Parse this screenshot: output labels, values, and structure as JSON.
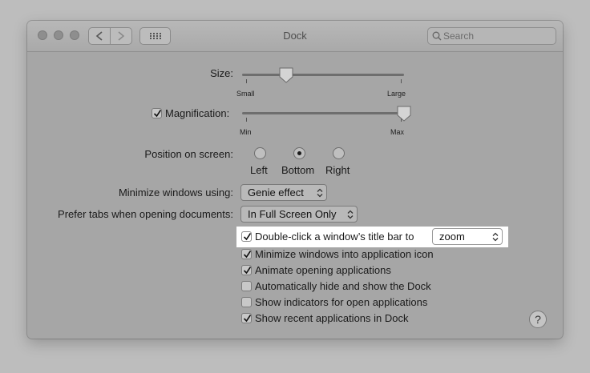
{
  "window": {
    "title": "Dock",
    "search_placeholder": "Search"
  },
  "size": {
    "label": "Size:",
    "min_label": "Small",
    "max_label": "Large",
    "value_fraction": 0.27
  },
  "magnification": {
    "label": "Magnification:",
    "checked": true,
    "min_label": "Min",
    "max_label": "Max",
    "value_fraction": 1.0
  },
  "position": {
    "label": "Position on screen:",
    "options": [
      "Left",
      "Bottom",
      "Right"
    ],
    "selected": "Bottom"
  },
  "minimize": {
    "label": "Minimize windows using:",
    "value": "Genie effect"
  },
  "prefer_tabs": {
    "label": "Prefer tabs when opening documents:",
    "value": "In Full Screen Only"
  },
  "double_click": {
    "label": "Double-click a window’s title bar to",
    "checked": true,
    "value": "zoom"
  },
  "checkboxes": [
    {
      "label": "Minimize windows into application icon",
      "checked": true
    },
    {
      "label": "Animate opening applications",
      "checked": true
    },
    {
      "label": "Automatically hide and show the Dock",
      "checked": false
    },
    {
      "label": "Show indicators for open applications",
      "checked": false
    },
    {
      "label": "Show recent applications in Dock",
      "checked": true
    }
  ],
  "help": {
    "label": "?"
  }
}
